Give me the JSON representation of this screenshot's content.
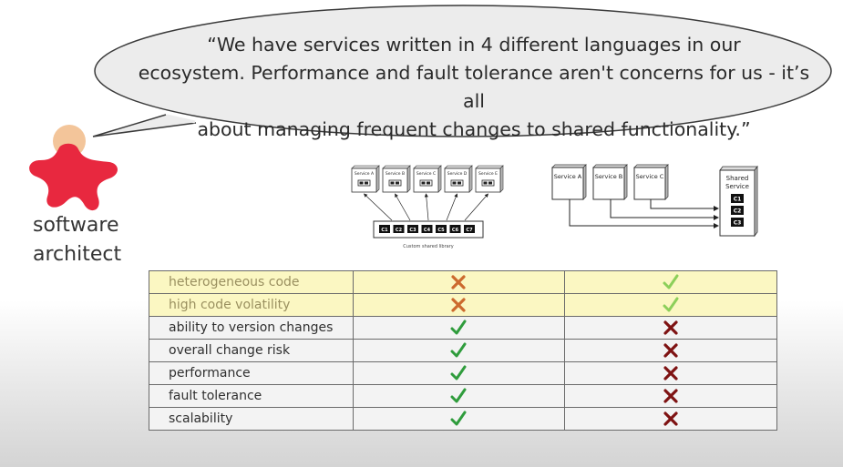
{
  "quote": {
    "line1": "“We have services written in 4 different languages in our",
    "line2": "ecosystem. Performance and fault tolerance aren't concerns for us - it’s all",
    "line3": "about managing frequent changes to shared functionality.”"
  },
  "role": {
    "line1": "software",
    "line2": "architect"
  },
  "left_diagram": {
    "services": [
      "Service A",
      "Service B",
      "Service C",
      "Service D",
      "Service E"
    ],
    "library_components": [
      "C1",
      "C2",
      "C3",
      "C4",
      "C5",
      "C6",
      "C7"
    ],
    "library_label": "Custom shared library"
  },
  "right_diagram": {
    "services": [
      "Service A",
      "Service B",
      "Service C"
    ],
    "shared_title_1": "Shared",
    "shared_title_2": "Service",
    "shared_components": [
      "C1",
      "C2",
      "C3"
    ]
  },
  "comparison": {
    "rows": [
      {
        "label": "heterogeneous code",
        "left": "cross",
        "right": "check",
        "highlight": true
      },
      {
        "label": "high code volatility",
        "left": "cross",
        "right": "check",
        "highlight": true
      },
      {
        "label": "ability to version changes",
        "left": "check",
        "right": "cross",
        "highlight": false
      },
      {
        "label": "overall change risk",
        "left": "check",
        "right": "cross",
        "highlight": false
      },
      {
        "label": "performance",
        "left": "check",
        "right": "cross",
        "highlight": false
      },
      {
        "label": "fault tolerance",
        "left": "check",
        "right": "cross",
        "highlight": false
      },
      {
        "label": "scalability",
        "left": "check",
        "right": "cross",
        "highlight": false
      }
    ]
  },
  "colors": {
    "avatar_red": "#e8283f",
    "avatar_head": "#f3c59a",
    "check_green": "#2f9c3c",
    "check_light": "#8ccf5a",
    "cross_dark": "#7e1212",
    "cross_orange": "#cc6a2e",
    "highlight_row": "#fbf7c2"
  },
  "icons": [
    "speech-bubble",
    "star-person",
    "check-icon",
    "cross-icon"
  ]
}
